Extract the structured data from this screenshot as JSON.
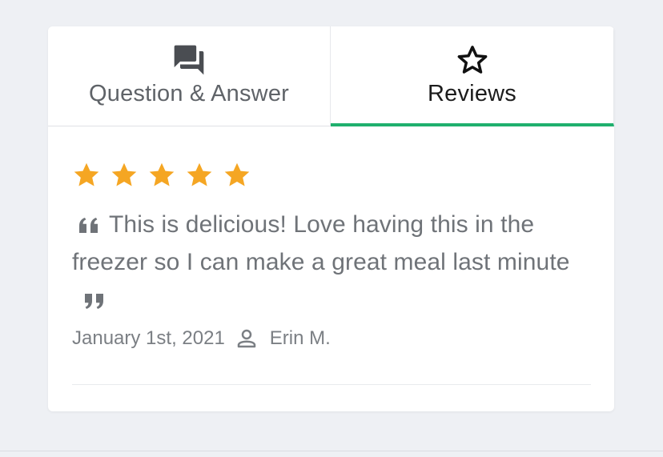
{
  "tabs": [
    {
      "label": "Question & Answer",
      "icon": "forum-icon",
      "active": false
    },
    {
      "label": "Reviews",
      "icon": "star-outline-icon",
      "active": true
    }
  ],
  "colors": {
    "active_tab_underline": "#1fb06e",
    "star": "#f5a623",
    "text_muted": "#6f7378"
  },
  "review": {
    "rating": 5,
    "rating_max": 5,
    "text": "This is delicious! Love having this in the freezer so I can make a great meal last minute",
    "date": "January 1st, 2021",
    "author": "Erin M."
  }
}
